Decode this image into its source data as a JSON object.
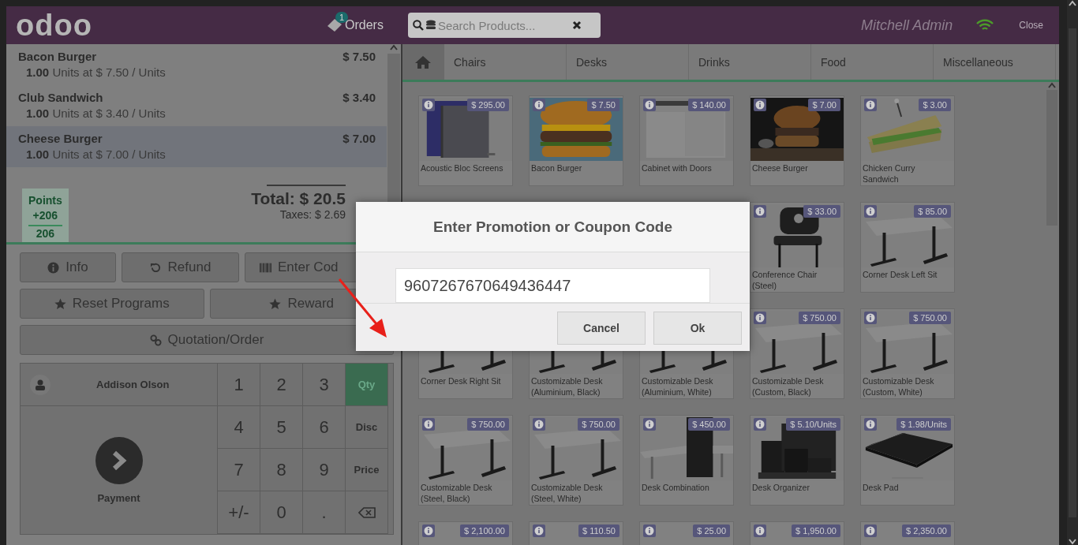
{
  "header": {
    "logo": "odoo",
    "orders": {
      "label": "Orders",
      "count": "1"
    },
    "search": {
      "placeholder": "Search Products..."
    },
    "user": "Mitchell Admin",
    "close": "Close"
  },
  "order_lines": [
    {
      "name": "Bacon Burger",
      "price": "$ 7.50",
      "qty": "1.00",
      "detail": "Units at $ 7.50 / Units",
      "selected": false
    },
    {
      "name": "Club Sandwich",
      "price": "$ 3.40",
      "qty": "1.00",
      "detail": "Units at $ 3.40 / Units",
      "selected": false
    },
    {
      "name": "Cheese Burger",
      "price": "$ 7.00",
      "qty": "1.00",
      "detail": "Units at $ 7.00 / Units",
      "selected": true
    }
  ],
  "points": {
    "label": "Points",
    "gained": "+206",
    "balance": "206"
  },
  "totals": {
    "total": "Total: $ 20.5",
    "taxes": "Taxes: $ 2.69"
  },
  "control_buttons": [
    [
      {
        "kind": "info",
        "label": "Info"
      },
      {
        "kind": "refund",
        "label": "Refund"
      },
      {
        "kind": "barcode",
        "label": "Enter Cod"
      }
    ],
    [
      {
        "kind": "star",
        "label": "Reset Programs"
      },
      {
        "kind": "star",
        "label": "Reward"
      }
    ],
    [
      {
        "kind": "link",
        "label": "Quotation/Order"
      }
    ]
  ],
  "customer": "Addison Olson",
  "payment": "Payment",
  "numpad": [
    {
      "kind": "digit",
      "label": "1"
    },
    {
      "kind": "digit",
      "label": "2"
    },
    {
      "kind": "digit",
      "label": "3"
    },
    {
      "kind": "mode",
      "label": "Qty",
      "selected": true
    },
    {
      "kind": "digit",
      "label": "4"
    },
    {
      "kind": "digit",
      "label": "5"
    },
    {
      "kind": "digit",
      "label": "6"
    },
    {
      "kind": "mode",
      "label": "Disc",
      "selected": false
    },
    {
      "kind": "digit",
      "label": "7"
    },
    {
      "kind": "digit",
      "label": "8"
    },
    {
      "kind": "digit",
      "label": "9"
    },
    {
      "kind": "mode",
      "label": "Price",
      "selected": false
    },
    {
      "kind": "digit",
      "label": "+/-"
    },
    {
      "kind": "digit",
      "label": "0"
    },
    {
      "kind": "digit",
      "label": "."
    },
    {
      "kind": "backspace"
    }
  ],
  "categories": [
    "Chairs",
    "Desks",
    "Drinks",
    "Food",
    "Miscellaneous"
  ],
  "products": [
    {
      "kind": "tile",
      "name": "Acoustic Bloc Screens",
      "price": "$ 295.00"
    },
    {
      "kind": "tile",
      "name": "Bacon Burger",
      "price": "$ 7.50"
    },
    {
      "kind": "tile",
      "name": "Cabinet with Doors",
      "price": "$ 140.00"
    },
    {
      "kind": "tile",
      "name": "Cheese Burger",
      "price": "$ 7.00"
    },
    {
      "kind": "tile",
      "name": "Chicken Curry Sandwich",
      "price": "$ 3.00"
    },
    {
      "kind": "covered"
    },
    {
      "kind": "covered"
    },
    {
      "kind": "covered"
    },
    {
      "kind": "tile",
      "name": "Conference Chair (Steel)",
      "price": "$ 33.00"
    },
    {
      "kind": "tile",
      "name": "Corner Desk Left Sit",
      "price": "$ 85.00"
    },
    {
      "kind": "tile",
      "name": "Corner Desk Right Sit"
    },
    {
      "kind": "tile",
      "name": "Customizable Desk (Aluminium, Black)"
    },
    {
      "kind": "tile",
      "name": "Customizable Desk (Aluminium, White)"
    },
    {
      "kind": "tile",
      "name": "Customizable Desk (Custom, Black)",
      "price": "$ 750.00"
    },
    {
      "kind": "tile",
      "name": "Customizable Desk (Custom, White)",
      "price": "$ 750.00"
    },
    {
      "kind": "tile",
      "name": "Customizable Desk (Steel, Black)",
      "price": "$ 750.00"
    },
    {
      "kind": "tile",
      "name": "Customizable Desk (Steel, White)",
      "price": "$ 750.00"
    },
    {
      "kind": "tile",
      "name": "Desk Combination",
      "price": "$ 450.00"
    },
    {
      "kind": "tile",
      "name": "Desk Organizer",
      "price": "$ 5.10/Units"
    },
    {
      "kind": "tile",
      "name": "Desk Pad",
      "price": "$ 1.98/Units"
    },
    {
      "kind": "tile",
      "price": "$ 2,100.00"
    },
    {
      "kind": "tile",
      "price": "$ 110.50"
    },
    {
      "kind": "tile",
      "price": "$ 25.00"
    },
    {
      "kind": "tile",
      "price": "$ 1,950.00"
    },
    {
      "kind": "tile",
      "price": "$ 2,350.00"
    }
  ],
  "dialog": {
    "title": "Enter Promotion or Coupon Code",
    "value": "9607267670649436447",
    "buttons": [
      "Cancel",
      "Ok"
    ]
  }
}
